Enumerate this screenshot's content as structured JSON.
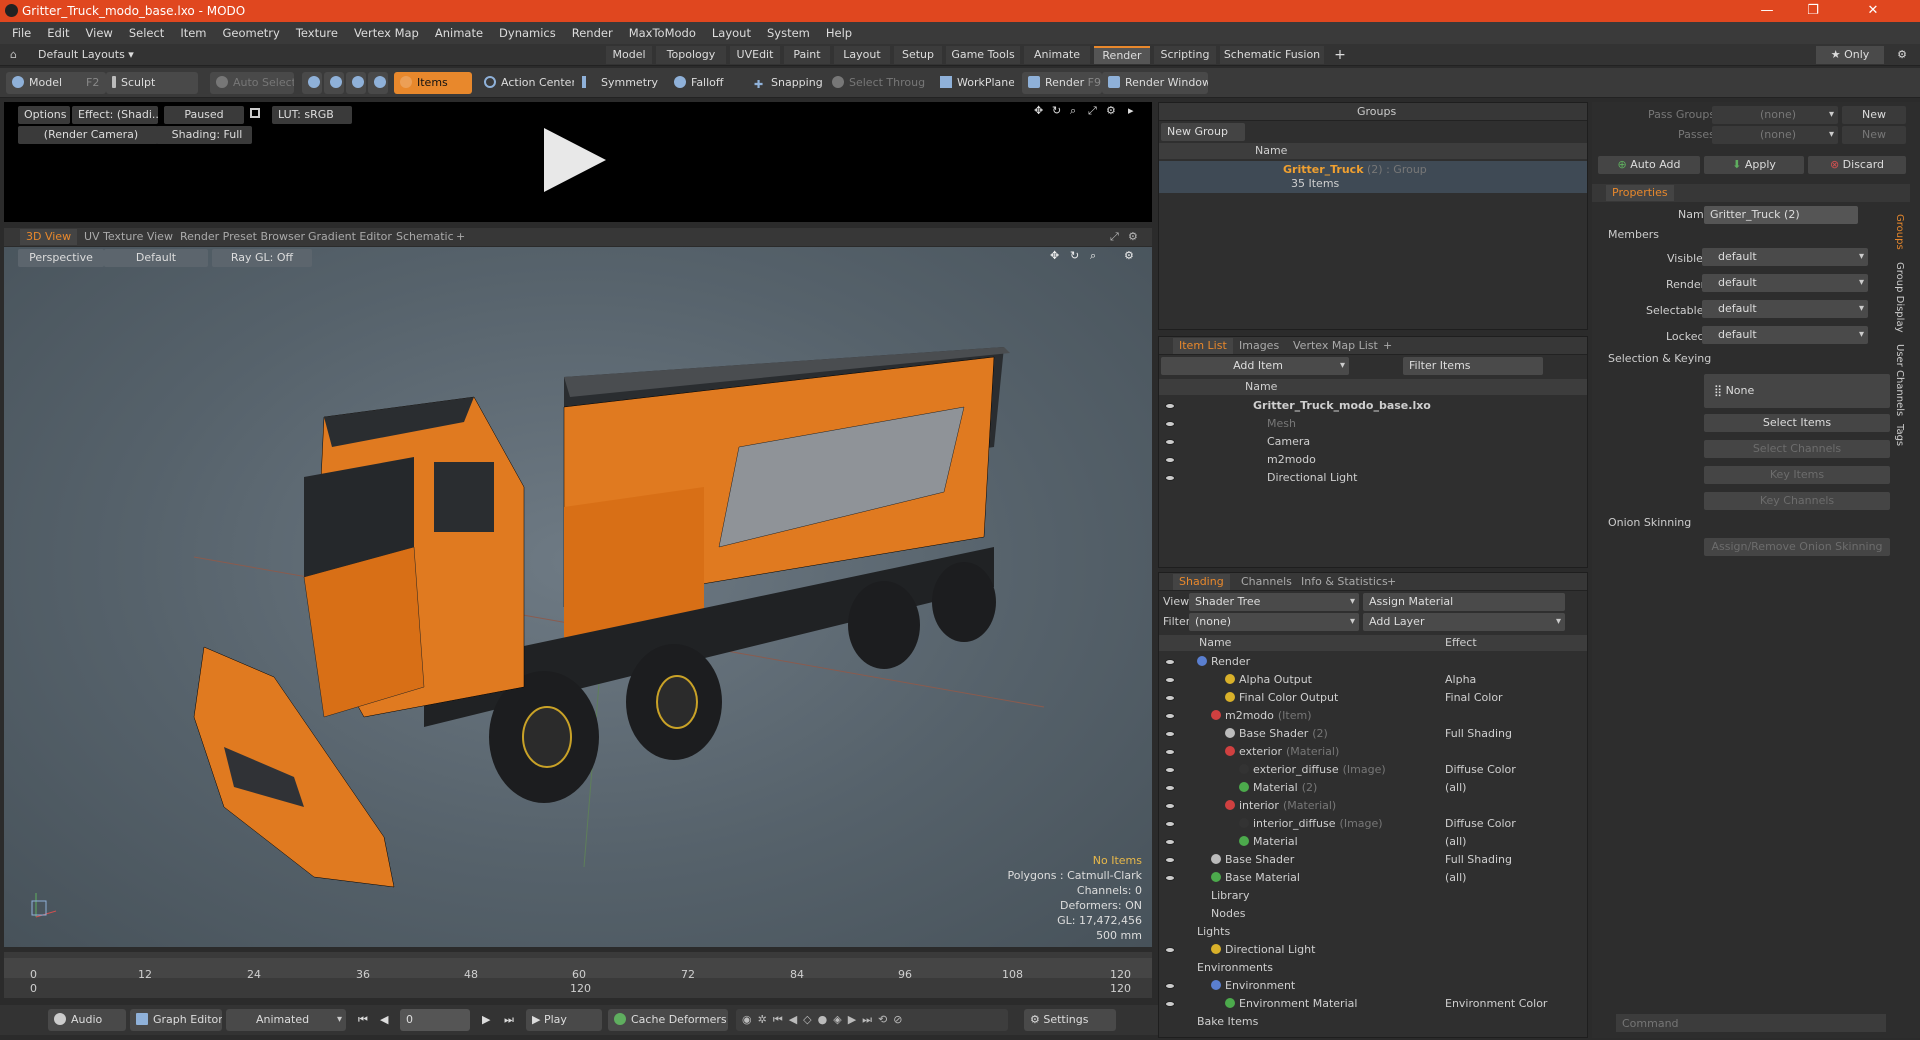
{
  "window": {
    "title": "Gritter_Truck_modo_base.lxo - MODO",
    "min": "—",
    "max": "❐",
    "close": "✕"
  },
  "menu": [
    "File",
    "Edit",
    "View",
    "Select",
    "Item",
    "Geometry",
    "Texture",
    "Vertex Map",
    "Animate",
    "Dynamics",
    "Render",
    "MaxToModo",
    "Layout",
    "System",
    "Help"
  ],
  "layouts": {
    "label": "Default Layouts ▾",
    "tabs": [
      "Model",
      "Topology",
      "UVEdit",
      "Paint",
      "Layout",
      "Setup",
      "Game Tools",
      "Animate",
      "Render",
      "Scripting",
      "Schematic Fusion",
      "+"
    ],
    "active": "Render",
    "only": "★ Only",
    "gear": "⚙"
  },
  "toolbar": {
    "model": "Model",
    "model_key": "F2",
    "sculpt": "Sculpt",
    "auto_select": "Auto Select",
    "items": "Items",
    "action_center": "Action Center",
    "symmetry": "Symmetry",
    "falloff": "Falloff",
    "snapping": "Snapping",
    "select_through": "Select Through",
    "workplane": "WorkPlane",
    "render": "Render",
    "render_key": "F9",
    "render_window": "Render Window"
  },
  "render_view": {
    "options": "Options",
    "effect": "Effect: (Shadi...",
    "paused": "Paused",
    "lut": "LUT: sRGB",
    "camera": "(Render Camera)",
    "shading": "Shading: Full"
  },
  "viewport_tabs": [
    "3D View",
    "UV Texture View",
    "Render Preset Browser",
    "Gradient Editor",
    "Schematic",
    "+"
  ],
  "viewport": {
    "perspective": "Perspective",
    "default": "Default",
    "raygl": "Ray GL: Off",
    "stats": [
      "No Items",
      "Polygons : Catmull-Clark",
      "Channels: 0",
      "Deformers: ON",
      "GL: 17,472,456",
      "500 mm"
    ]
  },
  "timeline": {
    "ticks": [
      "0",
      "12",
      "24",
      "36",
      "48",
      "60",
      "72",
      "84",
      "96",
      "108",
      "120"
    ],
    "sub": [
      "0",
      "120",
      "120"
    ]
  },
  "bottombar": {
    "audio": "Audio",
    "graph_editor": "Graph Editor",
    "animated": "Animated",
    "frame": "0",
    "play": "Play",
    "cache": "Cache Deformers",
    "settings": "Settings"
  },
  "groups": {
    "title": "Groups",
    "new_group": "New Group",
    "col_name": "Name",
    "item": "Gritter_Truck",
    "item_count": "(2) : Group",
    "sub": "35 Items"
  },
  "itemlist": {
    "tabs": [
      "Item List",
      "Images",
      "Vertex Map List",
      "+"
    ],
    "add_item": "Add Item",
    "filter": "Filter Items",
    "col_name": "Name",
    "rows": [
      {
        "label": "Gritter_Truck_modo_base.lxo",
        "indent": 0
      },
      {
        "label": "Mesh",
        "indent": 1,
        "dim": true
      },
      {
        "label": "Camera",
        "indent": 1
      },
      {
        "label": "m2modo",
        "indent": 1
      },
      {
        "label": "Directional Light",
        "indent": 1
      }
    ]
  },
  "shading": {
    "tabs": [
      "Shading",
      "Channels",
      "Info & Statistics",
      "+"
    ],
    "view_label": "View",
    "view": "Shader Tree",
    "assign": "Assign Material",
    "filter_label": "Filter",
    "filter": "(none)",
    "add_layer": "Add Layer",
    "col_name": "Name",
    "col_effect": "Effect",
    "rows": [
      {
        "n": "Render",
        "x": 0,
        "e": "",
        "c": "#5a7fd0"
      },
      {
        "n": "Alpha Output",
        "x": 2,
        "e": "Alpha",
        "c": "#d9b12a"
      },
      {
        "n": "Final Color Output",
        "x": 2,
        "e": "Final Color",
        "c": "#d9b12a"
      },
      {
        "n": "m2modo",
        "s": "(Item)",
        "x": 1,
        "e": "",
        "c": "#d04040"
      },
      {
        "n": "Base Shader",
        "s": "(2)",
        "x": 2,
        "e": "Full Shading",
        "c": "#bbbbbb"
      },
      {
        "n": "exterior",
        "s": "(Material)",
        "x": 2,
        "e": "",
        "c": "#d04040"
      },
      {
        "n": "exterior_diffuse",
        "s": "(Image)",
        "x": 3,
        "e": "Diffuse Color",
        "c": "#333333"
      },
      {
        "n": "Material",
        "s": "(2)",
        "x": 3,
        "e": "(all)",
        "c": "#4caa4c"
      },
      {
        "n": "interior",
        "s": "(Material)",
        "x": 2,
        "e": "",
        "c": "#d04040"
      },
      {
        "n": "interior_diffuse",
        "s": "(Image)",
        "x": 3,
        "e": "Diffuse Color",
        "c": "#333333"
      },
      {
        "n": "Material",
        "s": "",
        "x": 3,
        "e": "(all)",
        "c": "#4caa4c"
      },
      {
        "n": "Base Shader",
        "s": "",
        "x": 1,
        "e": "Full Shading",
        "c": "#bbbbbb"
      },
      {
        "n": "Base Material",
        "s": "",
        "x": 1,
        "e": "(all)",
        "c": "#4caa4c"
      },
      {
        "n": "Library",
        "s": "",
        "x": 1,
        "e": "",
        "c": ""
      },
      {
        "n": "Nodes",
        "s": "",
        "x": 1,
        "e": "",
        "c": ""
      },
      {
        "n": "Lights",
        "s": "",
        "x": 0,
        "e": "",
        "c": ""
      },
      {
        "n": "Directional Light",
        "s": "",
        "x": 1,
        "e": "",
        "c": "#d9b12a"
      },
      {
        "n": "Environments",
        "s": "",
        "x": 0,
        "e": "",
        "c": ""
      },
      {
        "n": "Environment",
        "s": "",
        "x": 1,
        "e": "",
        "c": "#5a7fd0"
      },
      {
        "n": "Environment Material",
        "s": "",
        "x": 2,
        "e": "Environment Color",
        "c": "#4caa4c"
      },
      {
        "n": "Bake Items",
        "s": "",
        "x": 0,
        "e": "",
        "c": ""
      }
    ]
  },
  "props": {
    "pass_groups": "Pass Groups",
    "passes": "Passes",
    "none": "(none)",
    "new": "New",
    "auto_add": "Auto Add",
    "apply": "Apply",
    "discard": "Discard",
    "tab": "Properties",
    "name_label": "Name",
    "name": "Gritter_Truck (2)",
    "members": "Members",
    "visible": "Visible",
    "render": "Render",
    "selectable": "Selectable",
    "locked": "Locked",
    "def": "default",
    "sel_keying": "Selection & Keying",
    "none_btn": "None",
    "select_items": "Select Items",
    "select_channels": "Select Channels",
    "key_items": "Key Items",
    "key_channels": "Key Channels",
    "onion": "Onion Skinning",
    "assign_onion": "Assign/Remove Onion Skinning",
    "side_tabs": [
      "Groups",
      "Group Display",
      "User Channels",
      "Tags"
    ]
  },
  "command": {
    "placeholder": "Command"
  }
}
